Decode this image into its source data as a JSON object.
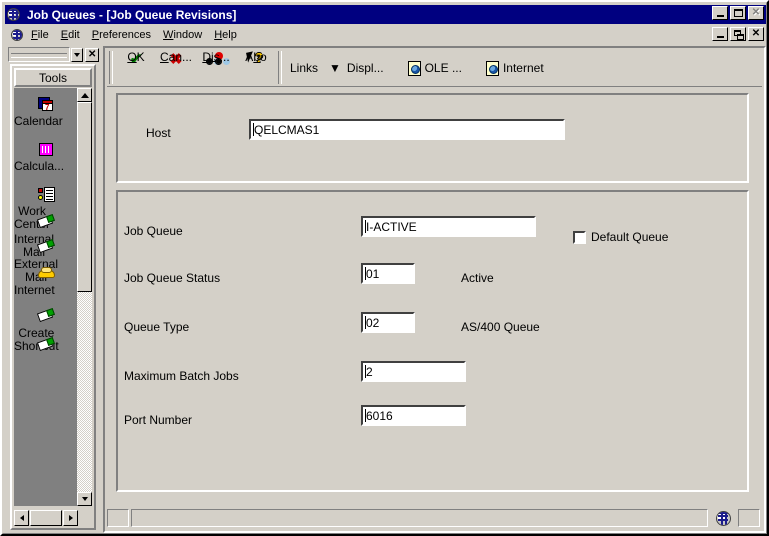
{
  "window": {
    "title": "Job Queues - [Job Queue Revisions]",
    "icon": "globe-icon",
    "controls": {
      "minimize": "_",
      "maximize": "□",
      "close": "✕"
    },
    "mdi_controls": {
      "minimize": "_",
      "restore": "❐",
      "close": "✕"
    }
  },
  "menubar": {
    "icon": "globe-icon",
    "items": [
      {
        "label": "File",
        "accel": "F"
      },
      {
        "label": "Edit",
        "accel": "E"
      },
      {
        "label": "Preferences",
        "accel": "P"
      },
      {
        "label": "Window",
        "accel": "W"
      },
      {
        "label": "Help",
        "accel": "H"
      }
    ]
  },
  "sidebar": {
    "combo_value": "",
    "close_label": "✕",
    "tab_label": "Tools",
    "items": [
      {
        "label": "Calendar",
        "icon": "calendar-icon"
      },
      {
        "label": "Calcula...",
        "icon": "calculator-icon"
      },
      {
        "label": "Work\nCenter",
        "icon": "work-center-icon"
      },
      {
        "label": "Internal\nMail",
        "icon": "mail-icon"
      },
      {
        "label": "External\nMail",
        "icon": "mail-icon"
      },
      {
        "label": "Internet",
        "icon": "phone-icon"
      },
      {
        "label": "Create\nShortcut",
        "icon": "mail-icon"
      },
      {
        "label": "",
        "icon": "mail-icon"
      }
    ],
    "scroll_up": "▲",
    "scroll_down": "▼",
    "scroll_left": "◀",
    "scroll_right": "▶"
  },
  "toolbar": {
    "buttons": [
      {
        "label": "OK",
        "accel": "O",
        "icon": "checkmark-icon"
      },
      {
        "label": "Can...",
        "accel": "C",
        "icon": "cancel-x-icon"
      },
      {
        "label": "Dis...",
        "accel": "D",
        "icon": "display-glasses-icon"
      },
      {
        "label": "Abo",
        "accel": "b",
        "icon": "arrow-question-icon"
      }
    ],
    "links_label": "Links",
    "dropdown_arrow": "▼",
    "display_label": "Displ...",
    "ole_label": "OLE ...",
    "ole_icon": "document-globe-icon",
    "internet_label": "Internet",
    "internet_icon": "document-globe-icon"
  },
  "form": {
    "host": {
      "label": "Host",
      "value": "QELCMAS1"
    },
    "job_queue": {
      "label": "Job Queue",
      "value": "I-ACTIVE"
    },
    "default_queue": {
      "label": "Default Queue",
      "checked": false
    },
    "job_queue_status": {
      "label": "Job Queue Status",
      "value": "01",
      "description": "Active"
    },
    "queue_type": {
      "label": "Queue Type",
      "value": "02",
      "description": "AS/400 Queue"
    },
    "maximum_batch_jobs": {
      "label": "Maximum Batch Jobs",
      "value": "2"
    },
    "port_number": {
      "label": "Port Number",
      "value": "6016"
    }
  },
  "statusbar": {
    "left_cell": "",
    "message": "",
    "indicator_icon": "globe-icon",
    "right_cell": ""
  },
  "colors": {
    "face": "#d4d0c8",
    "title_active": "#000080",
    "sidebar_bg": "#808080",
    "field_bg": "#ffffff",
    "check": "#008000",
    "cancel": "#cc0000"
  }
}
